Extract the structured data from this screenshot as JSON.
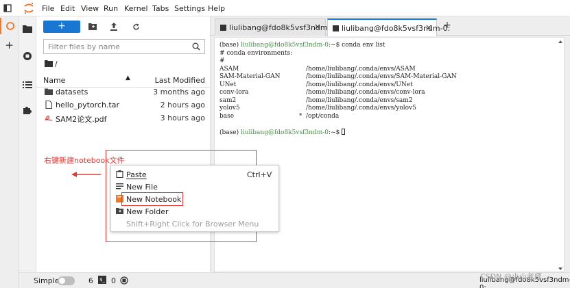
{
  "menubar": {
    "items": [
      "File",
      "Edit",
      "View",
      "Run",
      "Kernel",
      "Tabs",
      "Settings",
      "Help"
    ]
  },
  "activity": {
    "icons": [
      "folder-icon",
      "running-icon",
      "toc-icon",
      "extension-icon"
    ]
  },
  "filebrowser": {
    "new_label": "+",
    "filter_placeholder": "Filter files by name",
    "breadcrumb": "/",
    "header_name": "Name",
    "header_modified": "Last Modified",
    "files": [
      {
        "name": "datasets",
        "modified": "3 months ago",
        "icon": "folder-icon"
      },
      {
        "name": "hello_pytorch.tar",
        "modified": "2 hours ago",
        "icon": "file-icon"
      },
      {
        "name": "SAM2论文.pdf",
        "modified": "3 hours ago",
        "icon": "pdf-icon"
      }
    ]
  },
  "tabs": [
    {
      "label": "liulibang@fdo8k5vsf3ndm-0:",
      "active": false
    },
    {
      "label": "liulibang@fdo8k5vsf3ndm-0:",
      "active": true
    }
  ],
  "terminal": {
    "prompt_env": "(base) ",
    "prompt_user": "liulibang@fdo8k5vsf3ndm-0",
    "prompt_suffix": ":~$ ",
    "command": "conda env list",
    "lines": [
      "# conda environments:",
      "#"
    ],
    "envs": [
      {
        "name": "ASAM",
        "mark": "",
        "path": "/home/liulibang/.conda/envs/ASAM"
      },
      {
        "name": "SAM-Material-GAN",
        "mark": "",
        "path": "/home/liulibang/.conda/envs/SAM-Material-GAN"
      },
      {
        "name": "UNet",
        "mark": "",
        "path": "/home/liulibang/.conda/envs/UNet"
      },
      {
        "name": "conv-lora",
        "mark": "",
        "path": "/home/liulibang/.conda/envs/conv-lora"
      },
      {
        "name": "sam2",
        "mark": "",
        "path": "/home/liulibang/.conda/envs/sam2"
      },
      {
        "name": "yolov5",
        "mark": "",
        "path": "/home/liulibang/.conda/envs/yolov5"
      },
      {
        "name": "base",
        "mark": "*",
        "path": "/opt/conda"
      }
    ]
  },
  "context_menu": {
    "items": [
      {
        "label": "Paste",
        "shortcut": "Ctrl+V",
        "icon": "paste-icon",
        "disabled": false
      },
      {
        "label": "New File",
        "shortcut": "",
        "icon": "new-file-icon",
        "disabled": false
      },
      {
        "label": "New Notebook",
        "shortcut": "",
        "icon": "notebook-icon",
        "disabled": false
      },
      {
        "label": "New Folder",
        "shortcut": "",
        "icon": "new-folder-icon",
        "disabled": false
      },
      {
        "label": "Shift+Right Click for Browser Menu",
        "shortcut": "",
        "icon": "",
        "disabled": true
      }
    ]
  },
  "annotation": {
    "text": "右键新建notebook文件",
    "color": "#e53935"
  },
  "statusbar": {
    "mode": "Simple",
    "count_a": "6",
    "count_b": "0",
    "right_text": "liulibang@fdo8k5vsf3ndm-0:"
  },
  "watermark": "CSDN @小小老师",
  "colors": {
    "accent": "#1976d2",
    "jupyter_orange": "#f37726",
    "terminal_green": "#3a9a3a"
  }
}
